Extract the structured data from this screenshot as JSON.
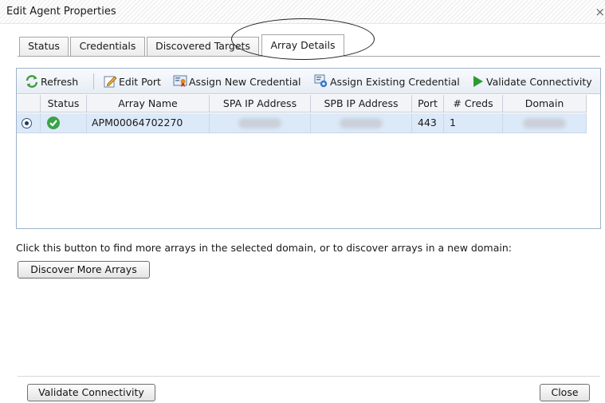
{
  "window": {
    "title": "Edit Agent Properties",
    "close_glyph": "×"
  },
  "tabs": [
    {
      "label": "Status",
      "active": false
    },
    {
      "label": "Credentials",
      "active": false
    },
    {
      "label": "Discovered Targets",
      "active": false
    },
    {
      "label": "Array Details",
      "active": true
    }
  ],
  "toolbar": {
    "refresh": {
      "label": "Refresh",
      "icon": "refresh-icon"
    },
    "edit_port": {
      "label": "Edit Port",
      "icon": "edit-icon"
    },
    "assign_new": {
      "label": "Assign New Credential",
      "icon": "credential-icon"
    },
    "assign_existing": {
      "label": "Assign Existing Credential",
      "icon": "credential-gear-icon"
    },
    "validate": {
      "label": "Validate Connectivity",
      "icon": "play-icon"
    }
  },
  "table": {
    "columns": [
      "Status",
      "Array Name",
      "SPA IP Address",
      "SPB IP Address",
      "Port",
      "# Creds",
      "Domain"
    ],
    "rows": [
      {
        "selected": true,
        "status": "ok",
        "array_name": "APM00064702270",
        "spa_ip": "",
        "spb_ip": "",
        "port": "443",
        "creds": "1",
        "domain": ""
      }
    ]
  },
  "info_text": "Click this button to find more arrays in the selected domain, or to discover arrays in a new domain:",
  "buttons": {
    "discover": "Discover More Arrays",
    "validate_connectivity": "Validate Connectivity",
    "close": "Close"
  },
  "colors": {
    "selection": "#dce9f8",
    "status_ok": "#3aa34a",
    "validate_icon": "#2f9a32",
    "refresh_icon": "#3b9b3b"
  }
}
